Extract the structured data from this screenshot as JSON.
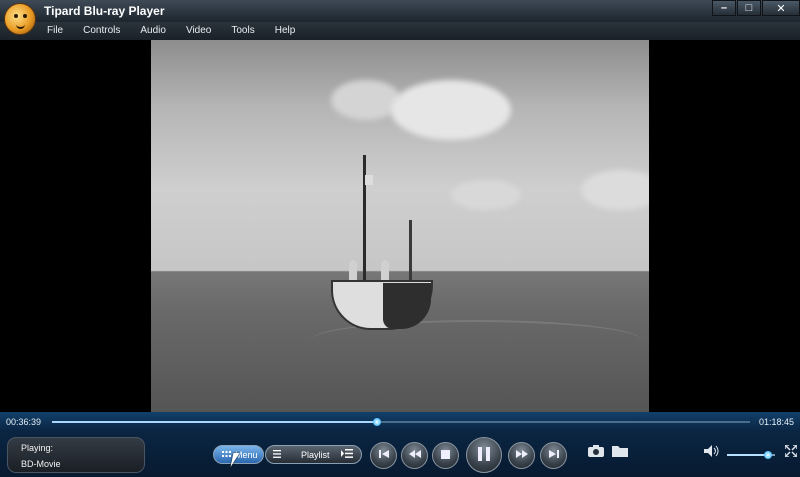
{
  "window": {
    "title": "Tipard Blu-ray Player",
    "minimize_glyph": "–",
    "maximize_glyph": "□",
    "close_glyph": "✕"
  },
  "menubar": {
    "items": [
      {
        "label": "File"
      },
      {
        "label": "Controls"
      },
      {
        "label": "Audio"
      },
      {
        "label": "Video"
      },
      {
        "label": "Tools"
      },
      {
        "label": "Help"
      }
    ]
  },
  "playback": {
    "current_time": "00:36:39",
    "total_time": "01:18:45",
    "progress_fraction": 0.465
  },
  "status": {
    "label": "Playing:",
    "title": "BD-Movie"
  },
  "buttons": {
    "menu_label": "Menu",
    "playlist_label": "Playlist"
  },
  "icons": {
    "menu": "grid-icon",
    "playlist": "list-icon",
    "playlist_toggle": "list-toggle-icon",
    "prev": "skip-previous-icon",
    "rewind": "rewind-icon",
    "stop": "stop-icon",
    "pause": "pause-icon",
    "forward": "fast-forward-icon",
    "next": "skip-next-icon",
    "snapshot": "camera-icon",
    "open": "folder-icon",
    "volume": "speaker-icon",
    "fullscreen": "fullscreen-icon"
  },
  "volume": {
    "level_fraction": 0.85
  },
  "colors": {
    "accent": "#5fc8ff",
    "control_bg": "#0a2542"
  }
}
